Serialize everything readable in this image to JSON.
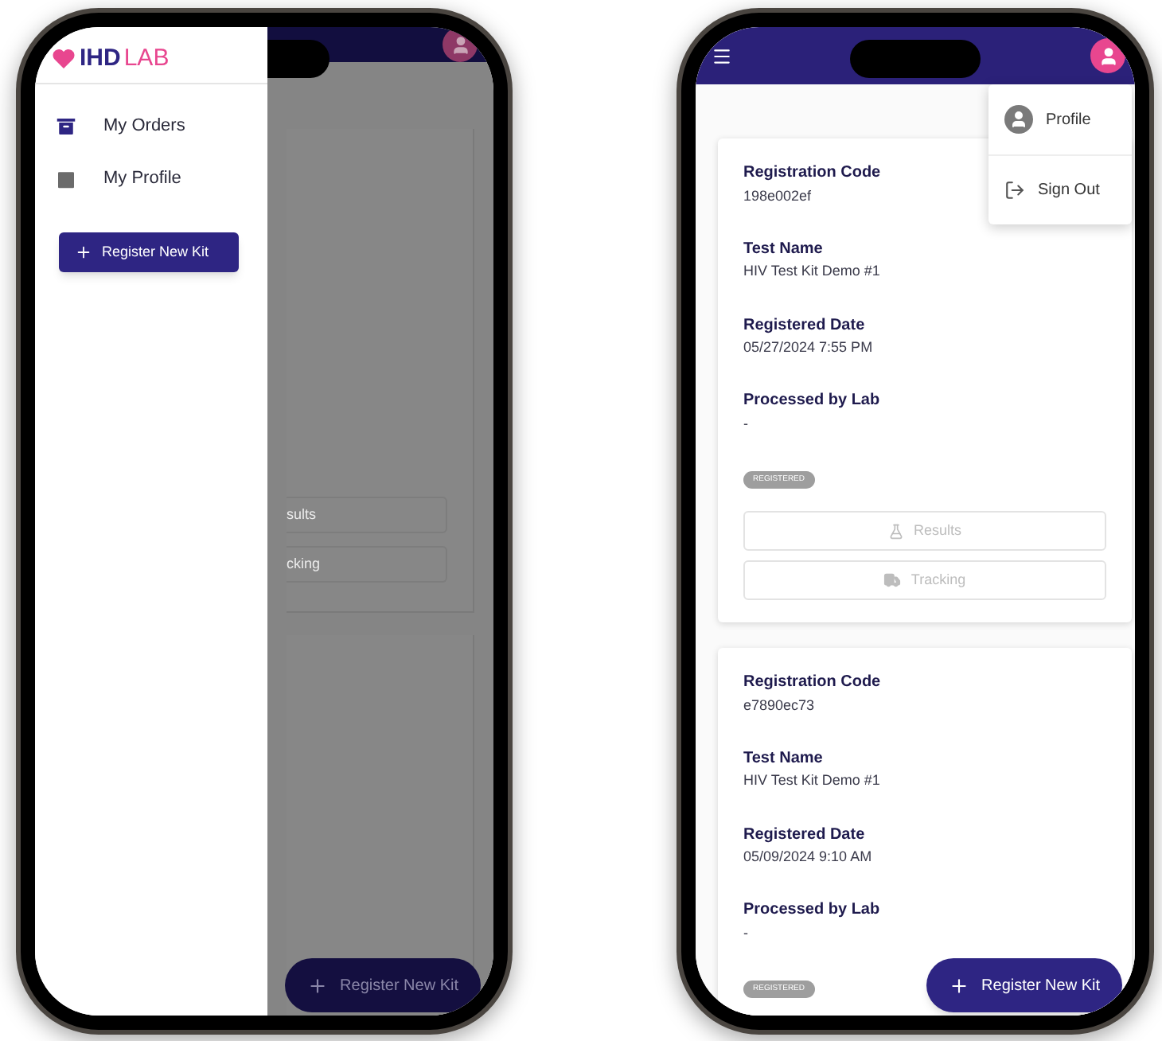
{
  "phones": [
    {
      "kind": "drawer",
      "logo": {
        "brand": "IHD",
        "suffix": "LAB"
      },
      "drawer_items": [
        {
          "label": "My Orders",
          "kind": "orders"
        },
        {
          "label": "My Profile",
          "kind": "profile"
        }
      ],
      "drawer_button": {
        "label": "Register New Kit"
      },
      "background_buttons": [
        {
          "label": "sults"
        },
        {
          "label": "cking"
        }
      ],
      "fab": {
        "label": "Register New Kit"
      }
    },
    {
      "kind": "orders",
      "menu": [
        {
          "label": "Profile",
          "kind": "profile"
        },
        {
          "label": "Sign Out",
          "kind": "signout"
        }
      ],
      "orders": [
        {
          "fields": [
            {
              "label": "Registration Code",
              "value": "198e002ef"
            },
            {
              "label": "Test Name",
              "value": "HIV Test Kit Demo #1"
            },
            {
              "label": "Registered Date",
              "value": "05/27/2024 7:55 PM"
            },
            {
              "label": "Processed by Lab",
              "value": "-"
            }
          ],
          "status": "REGISTERED",
          "actions": [
            {
              "label": "Results",
              "kind": "results",
              "disabled": true
            },
            {
              "label": "Tracking",
              "kind": "tracking",
              "disabled": true
            }
          ]
        },
        {
          "fields": [
            {
              "label": "Registration Code",
              "value": "e7890ec73"
            },
            {
              "label": "Test Name",
              "value": "HIV Test Kit Demo #1"
            },
            {
              "label": "Registered Date",
              "value": "05/09/2024 9:10 AM"
            },
            {
              "label": "Processed by Lab",
              "value": "-"
            }
          ],
          "status": "REGISTERED"
        }
      ],
      "fab": {
        "label": "Register New Kit"
      }
    }
  ]
}
